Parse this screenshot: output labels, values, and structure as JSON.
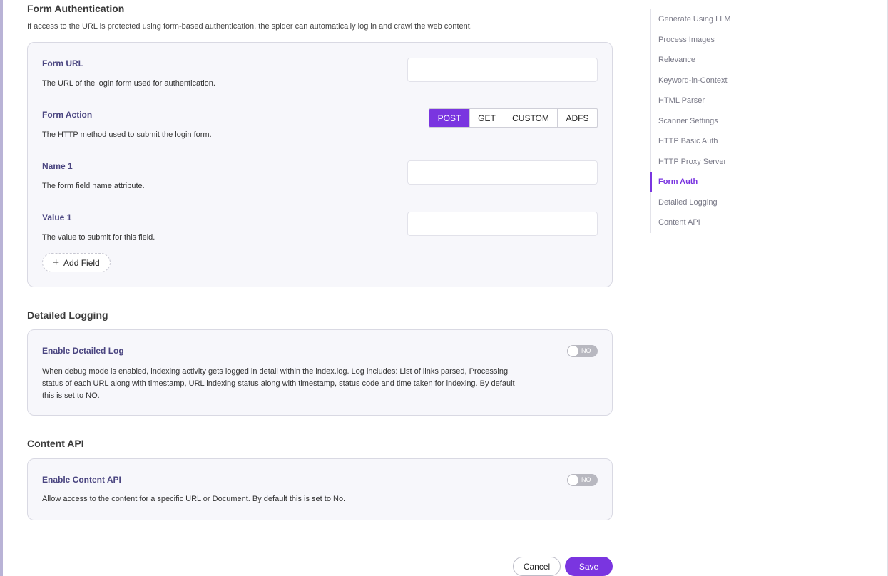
{
  "form_auth": {
    "title": "Form Authentication",
    "description": "If access to the URL is protected using form-based authentication, the spider can automatically log in and crawl the web content.",
    "form_url": {
      "label": "Form URL",
      "help": "The URL of the login form used for authentication.",
      "value": ""
    },
    "form_action": {
      "label": "Form Action",
      "help": "The HTTP method used to submit the login form.",
      "options": [
        "POST",
        "GET",
        "CUSTOM",
        "ADFS"
      ],
      "selected": "POST"
    },
    "name1": {
      "label": "Name 1",
      "help": "The form field name attribute.",
      "value": ""
    },
    "value1": {
      "label": "Value 1",
      "help": "The value to submit for this field.",
      "value": ""
    },
    "add_field_label": "Add Field"
  },
  "detailed_logging": {
    "title": "Detailed Logging",
    "label": "Enable Detailed Log",
    "help": "When debug mode is enabled, indexing activity gets logged in detail within the index.log. Log includes: List of links parsed, Processing status of each URL along with timestamp, URL indexing status along with timestamp, status code and time taken for indexing. By default this is set to NO.",
    "toggle": "NO"
  },
  "content_api": {
    "title": "Content API",
    "label": "Enable Content API",
    "help": "Allow access to the content for a specific URL or Document. By default this is set to No.",
    "toggle": "NO"
  },
  "footer": {
    "cancel": "Cancel",
    "save": "Save"
  },
  "toc": {
    "items": [
      "Generate Using LLM",
      "Process Images",
      "Relevance",
      "Keyword-in-Context",
      "HTML Parser",
      "Scanner Settings",
      "HTTP Basic Auth",
      "HTTP Proxy Server",
      "Form Auth",
      "Detailed Logging",
      "Content API"
    ],
    "active": "Form Auth"
  },
  "colors": {
    "accent": "#7a35e0",
    "label": "#4a4580",
    "toggle_off": "#b8b8c0"
  }
}
